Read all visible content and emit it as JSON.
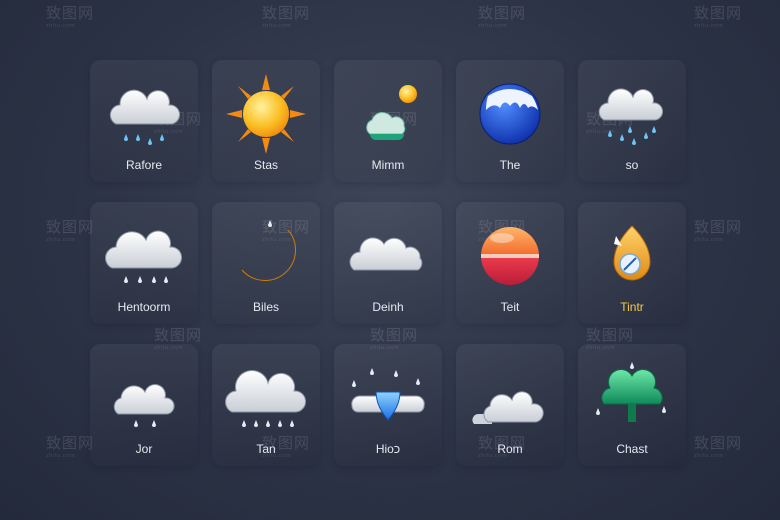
{
  "watermark": "致图网",
  "watermark_sub": "zhitu.com",
  "tiles": [
    {
      "label": "Rafore",
      "icon": "cloud-rain-icon"
    },
    {
      "label": "Stas",
      "icon": "sun-icon"
    },
    {
      "label": "Mimm",
      "icon": "cloud-sun-icon"
    },
    {
      "label": "The",
      "icon": "globe-icon"
    },
    {
      "label": "so",
      "icon": "cloud-rain-icon"
    },
    {
      "label": "Hentoorm",
      "icon": "cloud-rain-icon"
    },
    {
      "label": "Biles",
      "icon": "moon-icon"
    },
    {
      "label": "Deinh",
      "icon": "cloud-icon"
    },
    {
      "label": "Teit",
      "icon": "orb-icon"
    },
    {
      "label": "Tintr",
      "icon": "drop-badge-icon",
      "color": "#f2c94c"
    },
    {
      "label": "Jor",
      "icon": "cloud-drizzle-icon"
    },
    {
      "label": "Tan",
      "icon": "cloud-rain-icon"
    },
    {
      "label": "Hioכ",
      "icon": "raindrop-icon"
    },
    {
      "label": "Rom",
      "icon": "cloud-icon"
    },
    {
      "label": "Chast",
      "icon": "tree-icon"
    }
  ]
}
